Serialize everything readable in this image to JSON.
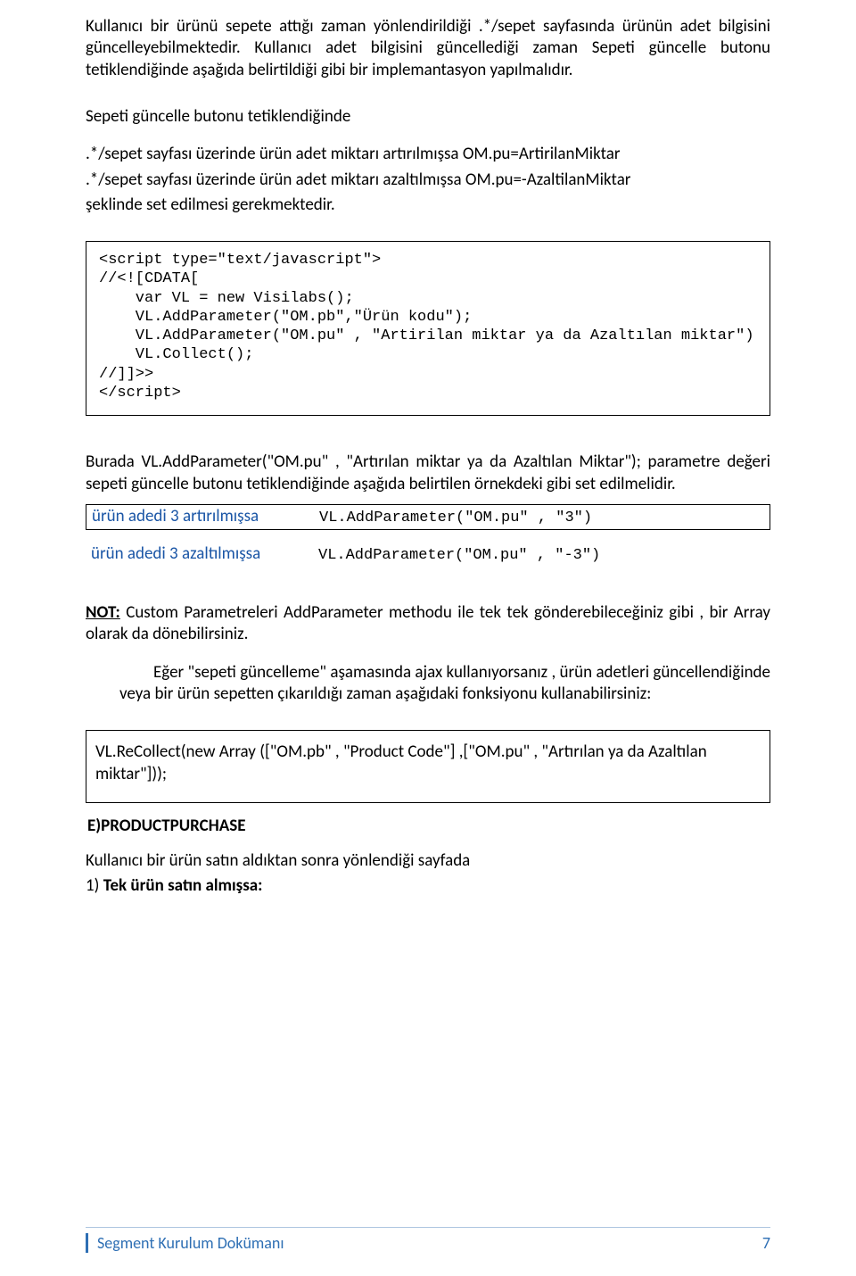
{
  "paragraphs": {
    "p1": "Kullanıcı bir ürünü sepete attığı zaman yönlendirildiği .*/sepet sayfasında ürünün adet bilgisini güncelleyebilmektedir. Kullanıcı adet bilgisini güncellediği zaman Sepeti güncelle butonu tetiklendiğinde aşağıda belirtildiği gibi bir implemantasyon yapılmalıdır.",
    "p2": "Sepeti güncelle butonu tetiklendiğinde",
    "p3a": ".*/sepet sayfası üzerinde ürün adet miktarı artırılmışsa OM.pu=ArtirilanMiktar",
    "p3b": ".*/sepet sayfası üzerinde ürün adet miktarı azaltılmışsa OM.pu=-AzaltilanMiktar",
    "p3c": "şeklinde set edilmesi gerekmektedir.",
    "p4": "Burada VL.AddParameter(\"OM.pu\" , \"Artırılan miktar ya  da Azaltılan Miktar\"); parametre değeri sepeti  güncelle butonu tetiklendiğinde aşağıda belirtilen örnekdeki gibi set edilmelidir.",
    "not_label": "NOT:",
    "not_text": " Custom  Parametreleri  AddParameter methodu ile tek tek gönderebileceğiniz gibi , bir Array olarak da dönebilirsiniz.",
    "p5": "Eğer \"sepeti güncelleme\" aşamasında ajax kullanıyorsanız  ,  ürün adetleri güncellendiğinde veya bir ürün sepetten çıkarıldığı zaman aşağıdaki fonksiyonu kullanabilirsiniz:",
    "p6": "Kullanıcı bir ürün satın aldıktan sonra yönlendiği sayfada",
    "p7a": "1) ",
    "p7b": "Tek ürün satın almışsa:"
  },
  "code1": "<script type=\"text/javascript\">\n//<![CDATA[\n    var VL = new Visilabs();\n    VL.AddParameter(\"OM.pb\",\"Ürün kodu\");\n    VL.AddParameter(\"OM.pu\" , \"Artirilan miktar ya da Azaltılan miktar\")\n    VL.Collect();\n//]]>>\n</script>",
  "example1": {
    "label": "ürün adedi 3 artırılmışsa",
    "code": "VL.AddParameter(\"OM.pu\" , \"3\")"
  },
  "example2": {
    "label": "ürün adedi 3 azaltılmışsa",
    "code": "VL.AddParameter(\"OM.pu\" , \"-3\")"
  },
  "recollect": {
    "line1": "     VL.ReCollect(new Array ([\"OM.pb\" , \"Product Code\"] ,[\"OM.pu\" , \"Artırılan ya da Azaltılan",
    "line2": "miktar\"]));"
  },
  "section_e": "E)PRODUCTPURCHASE",
  "footer": {
    "title": "Segment Kurulum Dokümanı",
    "page": "7"
  }
}
